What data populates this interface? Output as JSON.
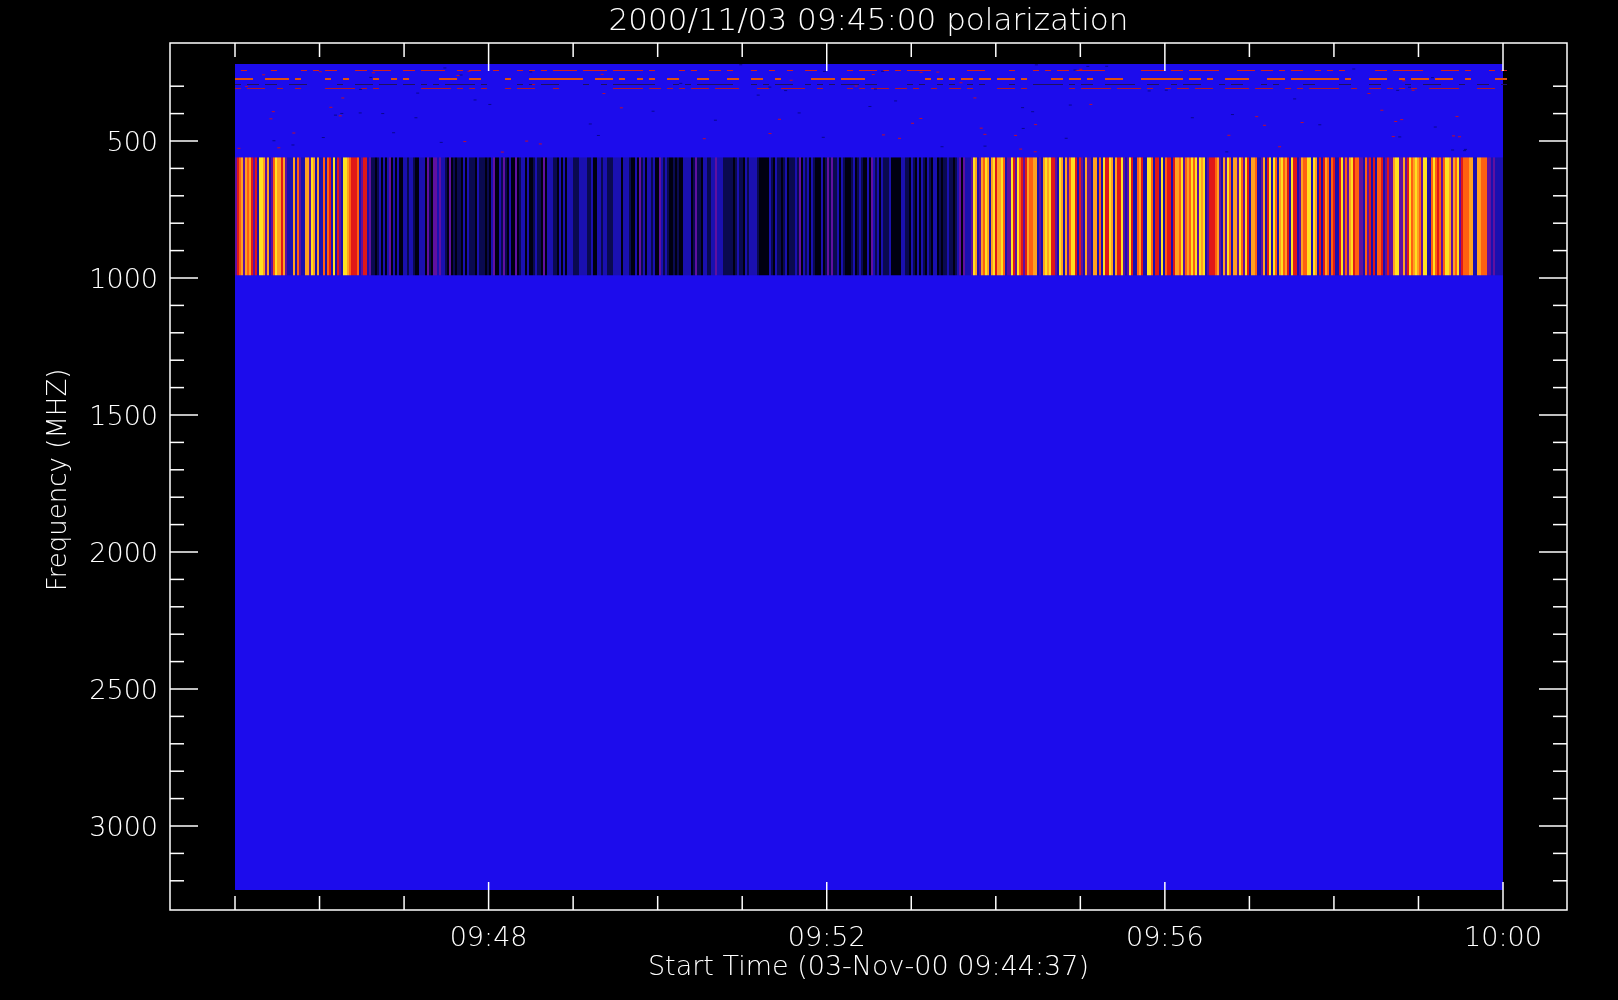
{
  "plot": {
    "title": "2000/11/03 09:45:00 polarization",
    "ylabel": "Frequency (MHZ)",
    "yticks": [
      "500",
      "1000",
      "1500",
      "2000",
      "2500",
      "3000"
    ],
    "xticks": [
      "09:48",
      "09:52",
      "09:56",
      "10:00"
    ],
    "xlabel": "Start Time (03-Nov-00 09:44:37)"
  }
}
